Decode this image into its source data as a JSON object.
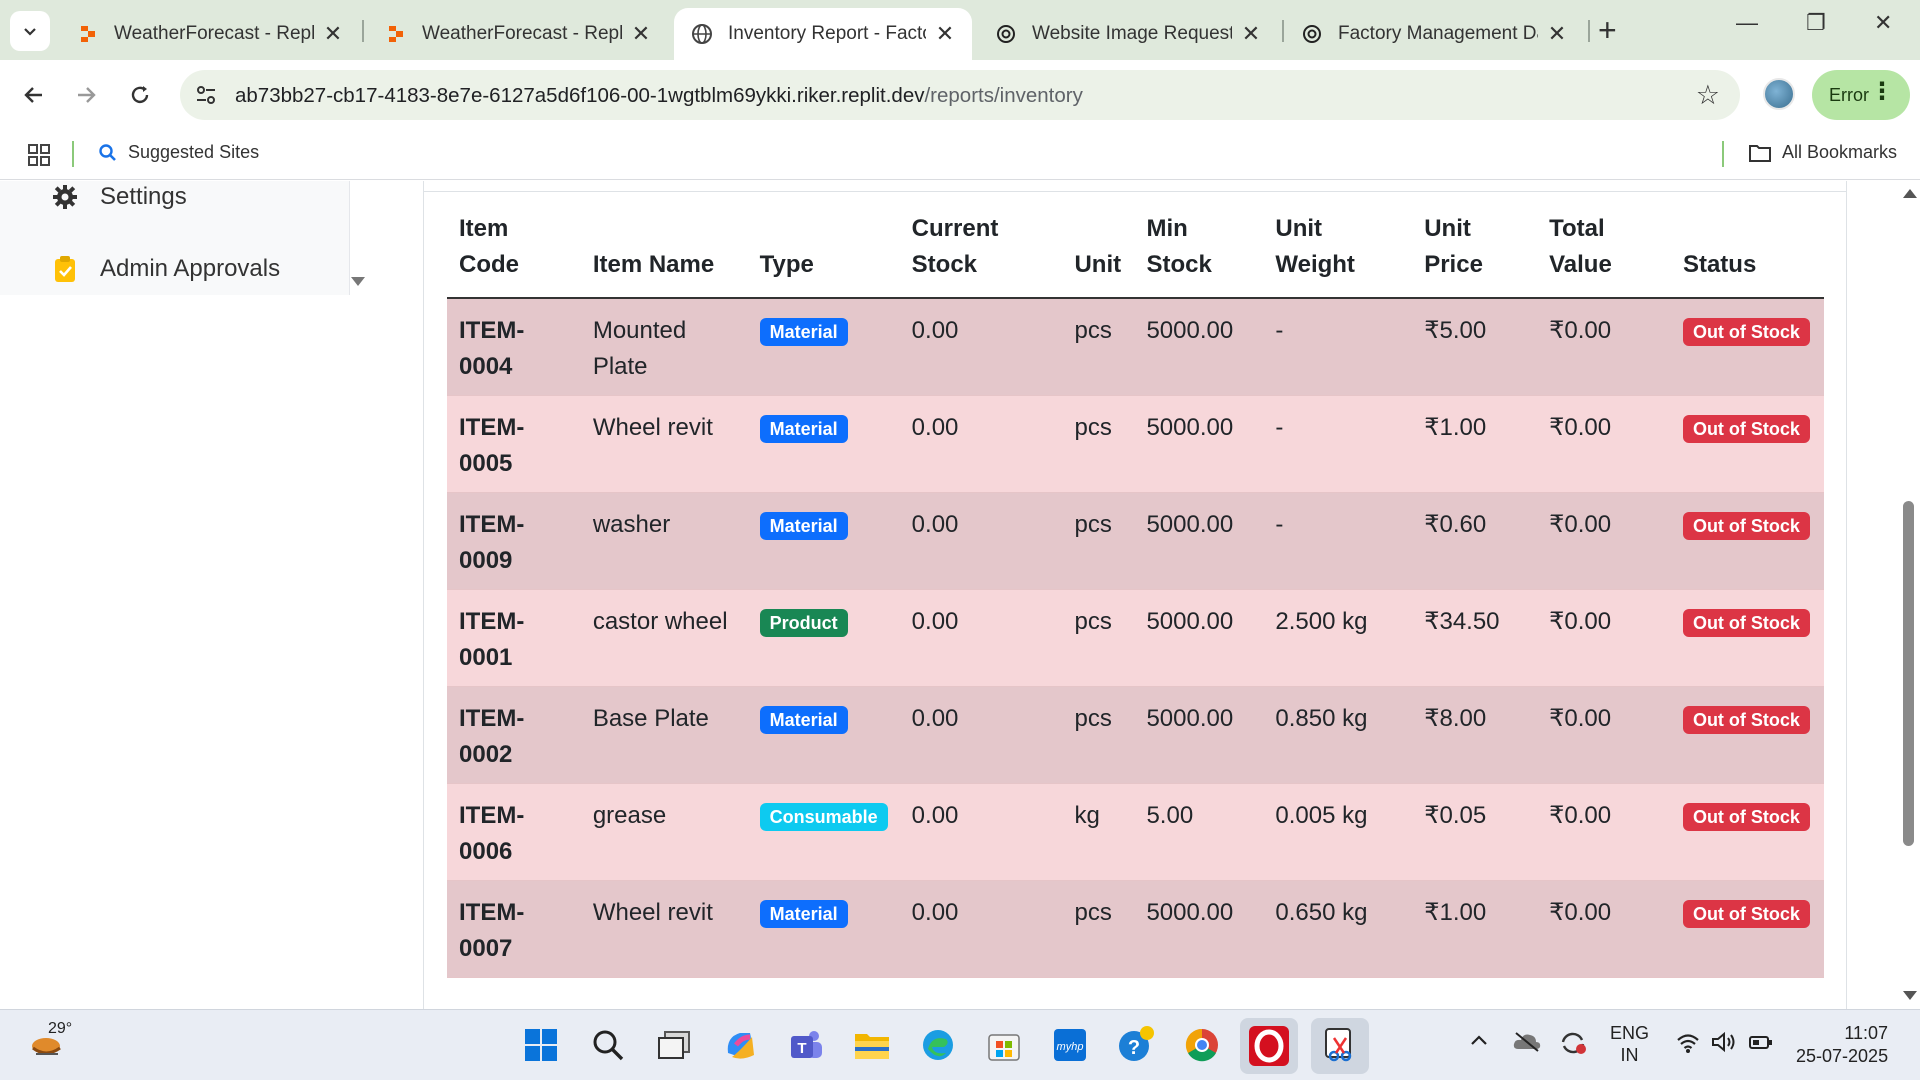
{
  "browser": {
    "tabs": [
      {
        "title": "WeatherForecast - Replit",
        "active": false
      },
      {
        "title": "WeatherForecast - Replit",
        "active": false
      },
      {
        "title": "Inventory Report - Factor",
        "active": true
      },
      {
        "title": "Website Image Request",
        "active": false
      },
      {
        "title": "Factory Management Dat",
        "active": false
      }
    ],
    "url_host": "ab73bb27-cb17-4183-8e7e-6127a5d6f106-00-1wgtblm69ykki.riker.replit.dev",
    "url_path": "/reports/inventory",
    "error_label": "Error",
    "bookmarks": {
      "suggested": "Suggested Sites",
      "all": "All Bookmarks"
    }
  },
  "sidebar": {
    "items": [
      {
        "label": "Settings",
        "icon": "gear-icon"
      },
      {
        "label": "Admin Approvals",
        "icon": "clipboard-check-icon"
      }
    ]
  },
  "inventory_table": {
    "headers": {
      "item_code": "Item Code",
      "item_name": "Item Name",
      "type": "Type",
      "current_stock": "Current Stock",
      "unit": "Unit",
      "min_stock": "Min Stock",
      "unit_weight": "Unit Weight",
      "unit_price": "Unit Price",
      "total_value": "Total Value",
      "status": "Status"
    },
    "rows": [
      {
        "code": "ITEM-0004",
        "name": "Mounted Plate",
        "type": "Material",
        "current": "0.00",
        "unit": "pcs",
        "min": "5000.00",
        "weight": "-",
        "price": "₹5.00",
        "total": "₹0.00",
        "status": "Out of Stock"
      },
      {
        "code": "ITEM-0005",
        "name": "Wheel revit",
        "type": "Material",
        "current": "0.00",
        "unit": "pcs",
        "min": "5000.00",
        "weight": "-",
        "price": "₹1.00",
        "total": "₹0.00",
        "status": "Out of Stock"
      },
      {
        "code": "ITEM-0009",
        "name": "washer",
        "type": "Material",
        "current": "0.00",
        "unit": "pcs",
        "min": "5000.00",
        "weight": "-",
        "price": "₹0.60",
        "total": "₹0.00",
        "status": "Out of Stock"
      },
      {
        "code": "ITEM-0001",
        "name": "castor wheel",
        "type": "Product",
        "current": "0.00",
        "unit": "pcs",
        "min": "5000.00",
        "weight": "2.500 kg",
        "price": "₹34.50",
        "total": "₹0.00",
        "status": "Out of Stock"
      },
      {
        "code": "ITEM-0002",
        "name": "Base Plate",
        "type": "Material",
        "current": "0.00",
        "unit": "pcs",
        "min": "5000.00",
        "weight": "0.850 kg",
        "price": "₹8.00",
        "total": "₹0.00",
        "status": "Out of Stock"
      },
      {
        "code": "ITEM-0006",
        "name": "grease",
        "type": "Consumable",
        "current": "0.00",
        "unit": "kg",
        "min": "5.00",
        "weight": "0.005 kg",
        "price": "₹0.05",
        "total": "₹0.00",
        "status": "Out of Stock"
      },
      {
        "code": "ITEM-0007",
        "name": "Wheel revit",
        "type": "Material",
        "current": "0.00",
        "unit": "pcs",
        "min": "5000.00",
        "weight": "0.650 kg",
        "price": "₹1.00",
        "total": "₹0.00",
        "status": "Out of Stock"
      }
    ]
  },
  "colors": {
    "material_badge": "#0d6efd",
    "product_badge": "#198754",
    "consumable_badge": "#0dcaf0",
    "out_of_stock_badge": "#dc3545",
    "row_tint_dark": "#e4c7cb",
    "row_tint_light": "#f7d7da"
  },
  "taskbar": {
    "temperature": "29°",
    "language": "ENG",
    "region": "IN",
    "time": "11:07",
    "date": "25-07-2025"
  }
}
